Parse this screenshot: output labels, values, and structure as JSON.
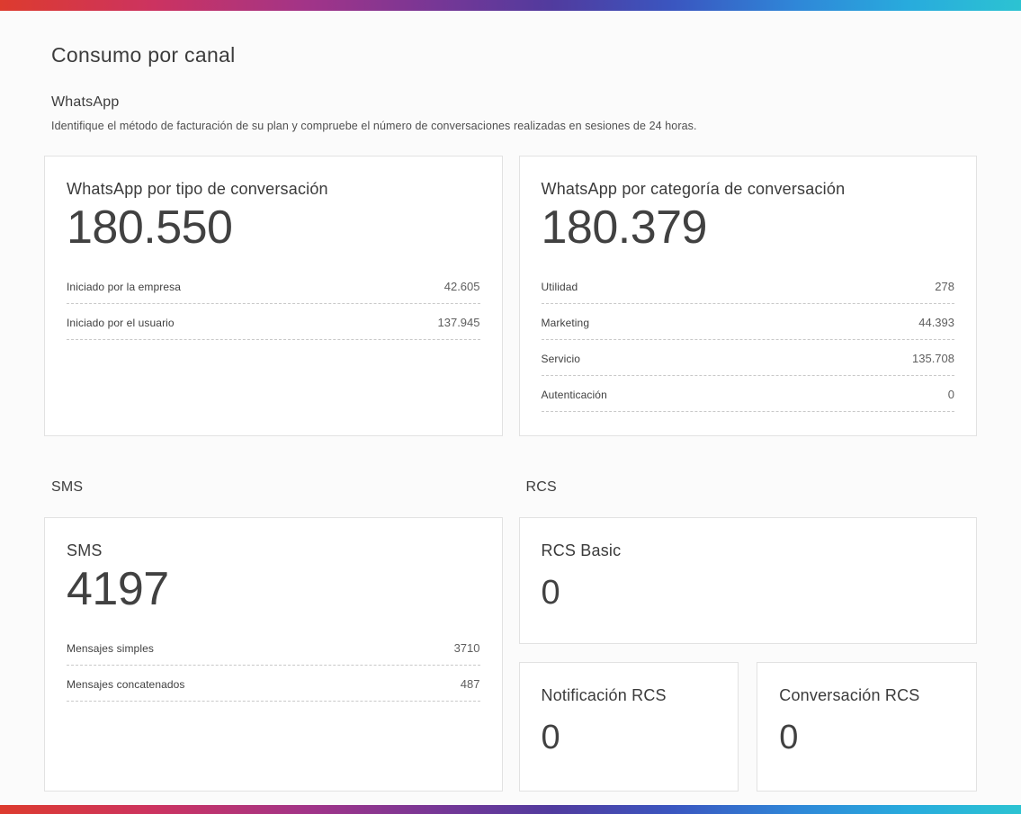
{
  "page": {
    "title": "Consumo por canal"
  },
  "whatsapp": {
    "heading": "WhatsApp",
    "description": "Identifique el método de facturación de su plan y compruebe el número de conversaciones realizadas en sesiones de 24 horas.",
    "by_type": {
      "title": "WhatsApp por tipo de conversación",
      "total": "180.550",
      "rows": [
        {
          "label": "Iniciado por la empresa",
          "value": "42.605"
        },
        {
          "label": "Iniciado por el usuario",
          "value": "137.945"
        }
      ]
    },
    "by_category": {
      "title": "WhatsApp por categoría de conversación",
      "total": "180.379",
      "rows": [
        {
          "label": "Utilidad",
          "value": "278"
        },
        {
          "label": "Marketing",
          "value": "44.393"
        },
        {
          "label": "Servicio",
          "value": "135.708"
        },
        {
          "label": "Autenticación",
          "value": "0"
        }
      ]
    }
  },
  "sms": {
    "heading": "SMS",
    "card": {
      "title": "SMS",
      "total": "4197",
      "rows": [
        {
          "label": "Mensajes simples",
          "value": "3710"
        },
        {
          "label": "Mensajes concatenados",
          "value": "487"
        }
      ]
    }
  },
  "rcs": {
    "heading": "RCS",
    "basic": {
      "title": "RCS Basic",
      "total": "0"
    },
    "notification": {
      "title": "Notificación RCS",
      "total": "0"
    },
    "conversation": {
      "title": "Conversación RCS",
      "total": "0"
    }
  }
}
